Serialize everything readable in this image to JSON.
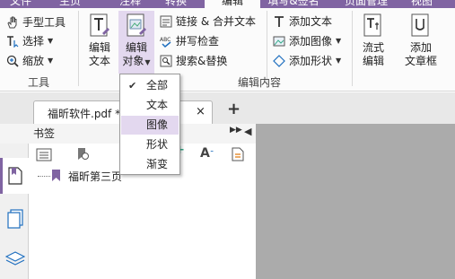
{
  "top_tabs": [
    "文件",
    "主页",
    "注释",
    "转换",
    "编辑",
    "填写&签名",
    "页面管理",
    "视图"
  ],
  "ribbon": {
    "tools_group": {
      "label": "工具",
      "items": [
        "手型工具",
        "选择",
        "缩放"
      ]
    },
    "edit_text": {
      "line1": "编辑",
      "line2": "文本"
    },
    "edit_object": {
      "line1": "编辑",
      "line2": "对象"
    },
    "misc_items": [
      "链接 & 合并文本",
      "拼写检查",
      "搜索&替换"
    ],
    "add_items": [
      "添加文本",
      "添加图像",
      "添加形状"
    ],
    "flow_edit": {
      "line1": "流式",
      "line2": "编辑"
    },
    "add_textbox": {
      "line1": "添加",
      "line2": "文章框"
    },
    "edit_content_group": {
      "label": "编辑内容"
    }
  },
  "dropdown": {
    "items": [
      "全部",
      "文本",
      "图像",
      "形状",
      "渐变"
    ],
    "checked": "全部",
    "highlighted": "图像"
  },
  "doc_tab": {
    "title": "福昕软件.pdf *"
  },
  "bookmarks": {
    "title": "书签",
    "entries": [
      "福昕第三页"
    ]
  },
  "colors": {
    "accent": "#8064a2",
    "highlight": "#e3d8ef",
    "canvas": "#ababab"
  }
}
